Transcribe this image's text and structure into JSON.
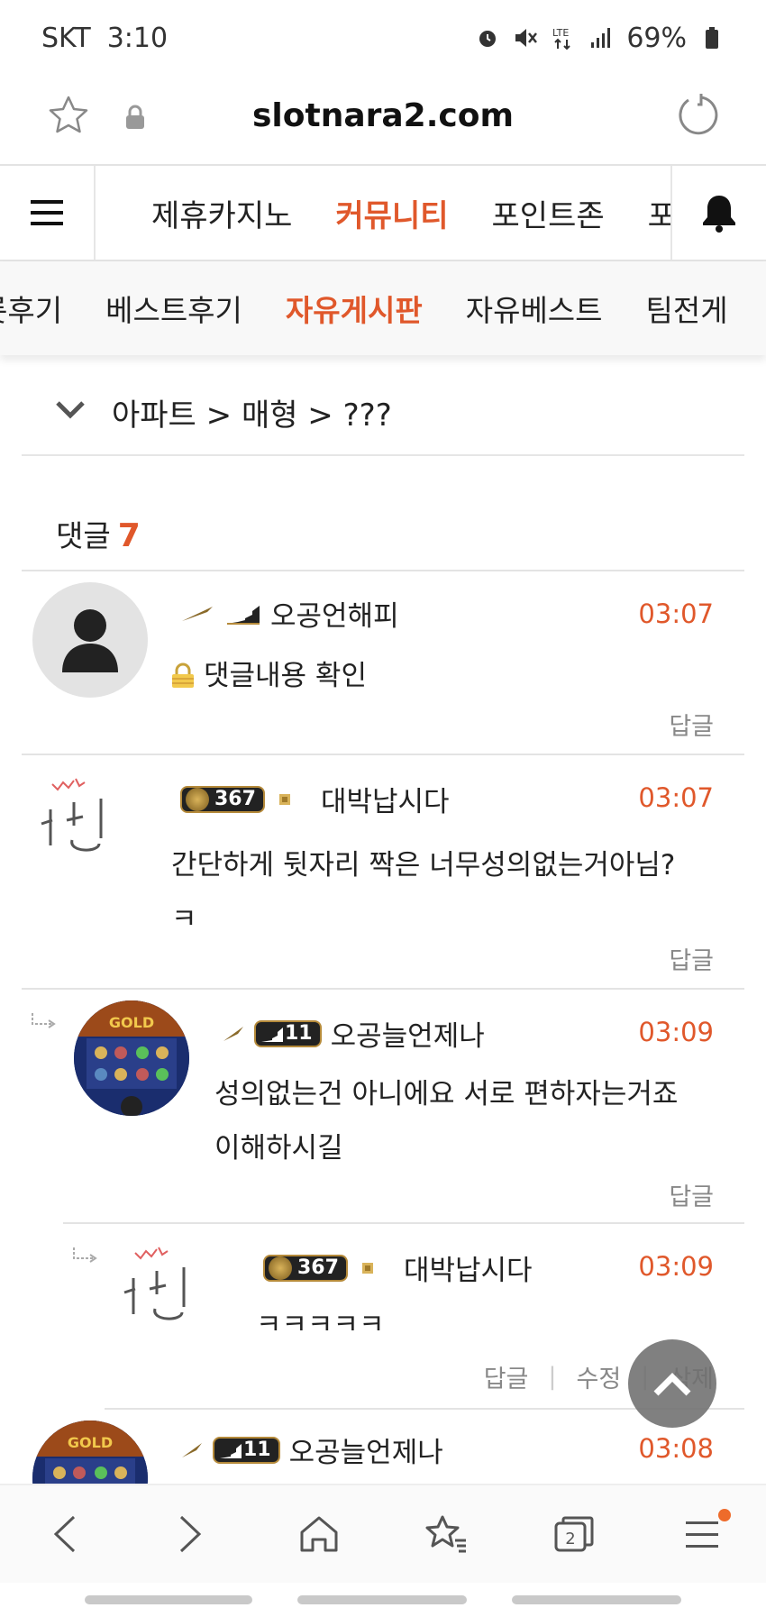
{
  "status_bar": {
    "carrier": "SKT",
    "time": "3:10",
    "battery": "69%",
    "network": "LTE"
  },
  "browser": {
    "url": "slotnara2.com"
  },
  "main_nav": {
    "items": [
      "제휴카지노",
      "커뮤니티",
      "포인트존",
      "포"
    ],
    "active_index": 1
  },
  "sub_nav": {
    "items": [
      "롯후기",
      "베스트후기",
      "자유게시판",
      "자유베스트",
      "팀전게"
    ],
    "active_index": 2
  },
  "breadcrumb": {
    "text": "아파트 > 매형 > ???"
  },
  "comments": {
    "label": "댓글",
    "count": "7",
    "items": [
      {
        "author": "오공언해피",
        "time": "03:07",
        "content": "댓글내용 확인",
        "reply_label": "답글",
        "level": ""
      },
      {
        "author": "대박납시다",
        "time": "03:07",
        "content": "간단하게 뒷자리 짝은 너무성의없는거아님?",
        "content2": "ㅋ",
        "reply_label": "답글",
        "level": "367"
      },
      {
        "author": "오공늘언제나",
        "time": "03:09",
        "content": "성의없는건 아니에요 서로 편하자는거죠",
        "content2": "이해하시길",
        "reply_label": "답글",
        "level": "11"
      },
      {
        "author": "대박납시다",
        "time": "03:09",
        "content": "ㅋㅋㅋㅋㅋ",
        "reply_label": "답글",
        "edit_label": "수정",
        "delete_label": "삭제",
        "level": "367"
      },
      {
        "author": "오공늘언제나",
        "time": "03:08",
        "level": "11"
      }
    ]
  },
  "colors": {
    "accent": "#e0582b",
    "divider": "#e3e3e3"
  }
}
